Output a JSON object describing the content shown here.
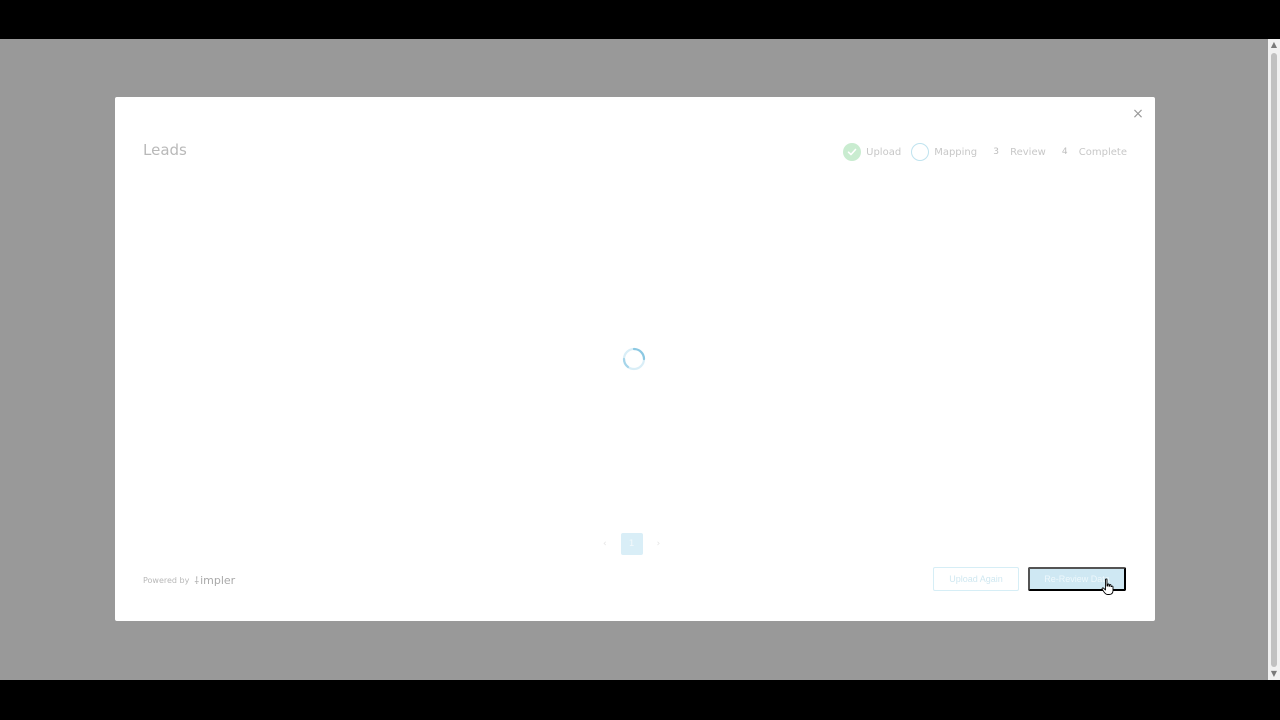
{
  "modal": {
    "title": "Leads",
    "close_label": "×"
  },
  "stepper": {
    "steps": [
      {
        "number": "",
        "label": "Upload",
        "state": "done"
      },
      {
        "number": "",
        "label": "Mapping",
        "state": "active"
      },
      {
        "number": "3",
        "label": "Review",
        "state": "pending"
      },
      {
        "number": "4",
        "label": "Complete",
        "state": "pending"
      }
    ]
  },
  "pagination": {
    "prev_label": "‹",
    "current_page": "1",
    "next_label": "›"
  },
  "footer": {
    "powered_by": "Powered by",
    "brand_mark": "⸸",
    "brand_name": "impler",
    "upload_again_label": "Upload Again",
    "re_review_label": "Re-Review Data"
  },
  "colors": {
    "overlay": "#999999",
    "accent": "#cfe8f3",
    "success": "#c9ecd0"
  },
  "icons": {
    "close": "close-icon",
    "check": "check-icon",
    "spinner": "loading-spinner-icon",
    "cursor": "hand-pointer-cursor-icon"
  }
}
